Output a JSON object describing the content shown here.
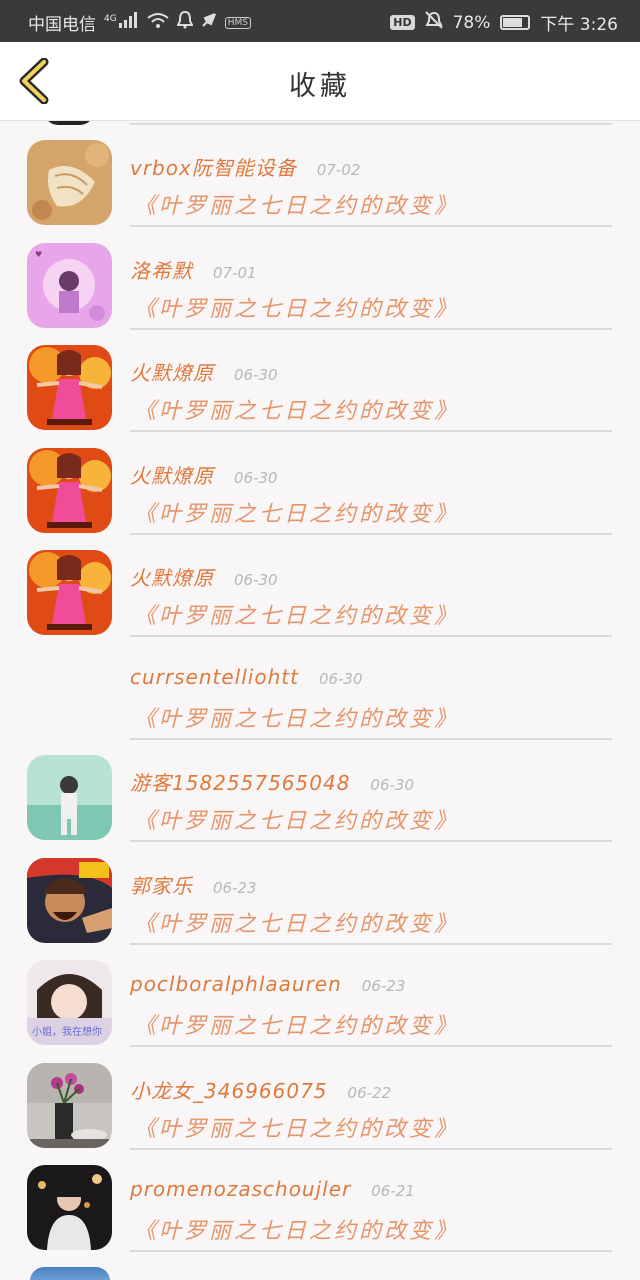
{
  "status_bar": {
    "carrier": "中国电信",
    "network": "4G",
    "hd_badge": "HD",
    "hms_badge": "HMS",
    "battery_pct": "78%",
    "battery_level": 0.78,
    "time": "下午 3:26"
  },
  "header": {
    "title": "收藏"
  },
  "items": [
    {
      "name": "vrbox阮智能设备",
      "date": "07-02",
      "subject": "《叶罗丽之七日之约的改变》",
      "avatar": "shell"
    },
    {
      "name": "洛希默",
      "date": "07-01",
      "subject": "《叶罗丽之七日之约的改变》",
      "avatar": "pink"
    },
    {
      "name": "火默燎原",
      "date": "06-30",
      "subject": "《叶罗丽之七日之约的改变》",
      "avatar": "fire"
    },
    {
      "name": "火默燎原",
      "date": "06-30",
      "subject": "《叶罗丽之七日之约的改变》",
      "avatar": "fire"
    },
    {
      "name": "火默燎原",
      "date": "06-30",
      "subject": "《叶罗丽之七日之约的改变》",
      "avatar": "fire"
    },
    {
      "name": "currsentelliohtt",
      "date": "06-30",
      "subject": "《叶罗丽之七日之约的改变》",
      "avatar": "none"
    },
    {
      "name": "游客1582557565048",
      "date": "06-30",
      "subject": "《叶罗丽之七日之约的改变》",
      "avatar": "mint"
    },
    {
      "name": "郭家乐",
      "date": "06-23",
      "subject": "《叶罗丽之七日之约的改变》",
      "avatar": "warrior"
    },
    {
      "name": "poclboralphlaauren",
      "date": "06-23",
      "subject": "《叶罗丽之七日之约的改变》",
      "avatar": "girl",
      "avatar_caption": "小姐，我在想你"
    },
    {
      "name": "小龙女_346966075",
      "date": "06-22",
      "subject": "《叶罗丽之七日之约的改变》",
      "avatar": "flower"
    },
    {
      "name": "promenozaschoujler",
      "date": "06-21",
      "subject": "《叶罗丽之七日之约的改变》",
      "avatar": "night"
    }
  ]
}
